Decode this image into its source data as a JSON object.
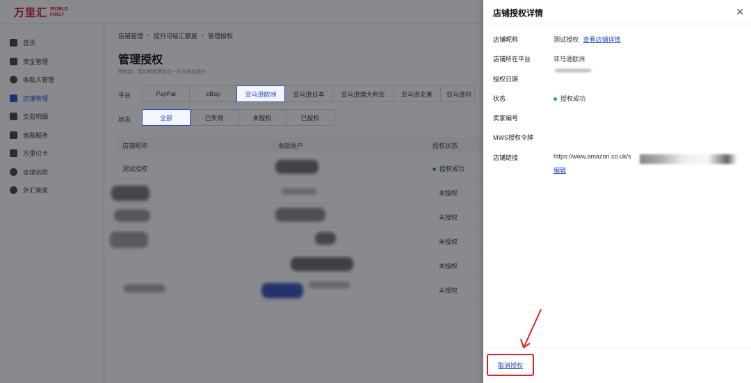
{
  "logo": {
    "cn": "万里汇",
    "en_line1": "WORLD",
    "en_line2": "FIRST"
  },
  "sidebar": {
    "items": [
      {
        "label": "首页",
        "icon": "home-icon"
      },
      {
        "label": "资金管理",
        "icon": "wallet-icon"
      },
      {
        "label": "收款人管理",
        "icon": "user-icon"
      },
      {
        "label": "店铺管理",
        "icon": "store-icon"
      },
      {
        "label": "交易明细",
        "icon": "list-icon"
      },
      {
        "label": "金融服务",
        "icon": "finance-icon"
      },
      {
        "label": "万里付卡",
        "icon": "card-icon"
      },
      {
        "label": "全球远航",
        "icon": "globe-icon"
      },
      {
        "label": "外汇管家",
        "icon": "fx-icon"
      }
    ],
    "active_index": 3
  },
  "breadcrumb": [
    "店铺管理",
    "提升可结汇额度",
    "管理授权"
  ],
  "page": {
    "title": "管理授权",
    "subtitle": "授权后，您的额度将会在一天内完成提升"
  },
  "filters": {
    "platform_label": "平台",
    "platforms": [
      "PayPal",
      "eBay",
      "亚马逊欧洲",
      "亚马逊日本",
      "亚马逊澳大利亚",
      "亚马逊北美",
      "亚马逊印"
    ],
    "platform_selected": 2,
    "status_label": "状态",
    "statuses": [
      "全部",
      "已失效",
      "未授权",
      "已授权"
    ],
    "status_selected": 0
  },
  "table": {
    "headers": [
      "店铺昵称",
      "收款账户",
      "授权状态"
    ],
    "rows": [
      {
        "name": "测试授权",
        "status": "授权成功",
        "success": true
      },
      {
        "name": "",
        "status": "未授权",
        "success": false
      },
      {
        "name": "",
        "status": "未授权",
        "success": false
      },
      {
        "name": "",
        "status": "未授权",
        "success": false
      },
      {
        "name": "",
        "status": "未授权",
        "success": false
      },
      {
        "name": "",
        "status": "未授权",
        "success": false
      }
    ]
  },
  "drawer": {
    "title": "店铺授权详情",
    "fields": {
      "nickname_label": "店铺昵称",
      "nickname_value": "测试授权",
      "nickname_link": "查看店铺详情",
      "platform_label": "店铺所在平台",
      "platform_value": "亚马逊欧洲",
      "date_label": "授权日期",
      "status_label": "状态",
      "status_value": "授权成功",
      "seller_label": "卖家编号",
      "mws_label": "MWS授权令牌",
      "store_link_label": "店铺链接",
      "store_link_value": "https://www.amazon.co.uk/s",
      "edit_label": "编辑"
    },
    "cancel_label": "取消授权"
  },
  "colors": {
    "brand_red": "#c8102e",
    "link_blue": "#2b4acb",
    "success_green": "#2aa44f",
    "highlight_red": "#e02020"
  }
}
